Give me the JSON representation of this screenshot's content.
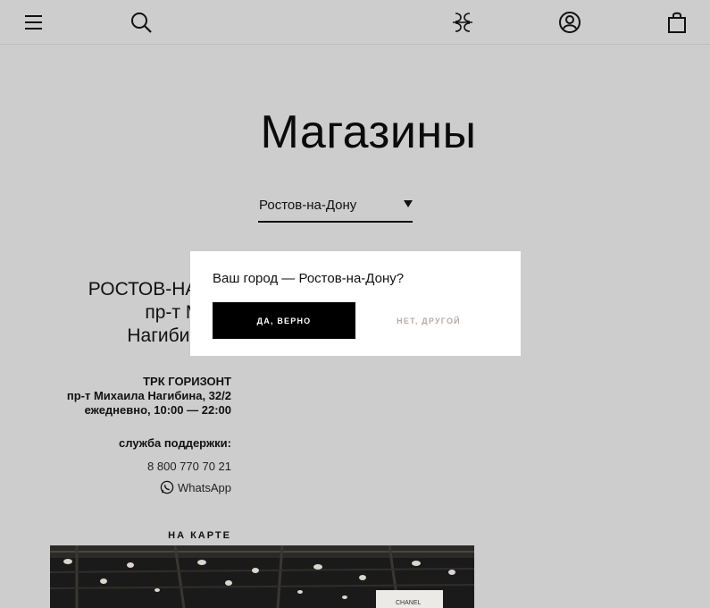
{
  "header": {
    "menu_icon": "hamburger-menu-icon",
    "search_icon": "search-icon",
    "logo_icon": "brand-logo-icon",
    "account_icon": "user-account-icon",
    "cart_icon": "shopping-bag-icon"
  },
  "page": {
    "title": "Магазины"
  },
  "city_select": {
    "value": "Ростов-на-Дону"
  },
  "store": {
    "title_line1": "РОСТОВ-НА-ДО",
    "title_line2": "пр-т Миха",
    "title_line3": "Нагибина, 3",
    "mall": "ТРК ГОРИЗОНТ",
    "address": "пр-т Михаила Нагибина, 32/2",
    "hours": "ежедневно, 10:00 — 22:00",
    "support_label": "служба поддержки:",
    "phone": "8 800 770 70 21",
    "whatsapp": "WhatsApp",
    "map_link": "НА КАРТЕ",
    "photo_sign": "CHANEL"
  },
  "popup": {
    "question": "Ваш город — Ростов-на-Дону?",
    "yes_label": "ДА, ВЕРНО",
    "no_label": "НЕТ, ДРУГОЙ"
  },
  "colors": {
    "background": "#cdcdcd",
    "popup_bg": "#ffffff",
    "primary_button": "#000000",
    "secondary_text": "#b8aca2"
  }
}
